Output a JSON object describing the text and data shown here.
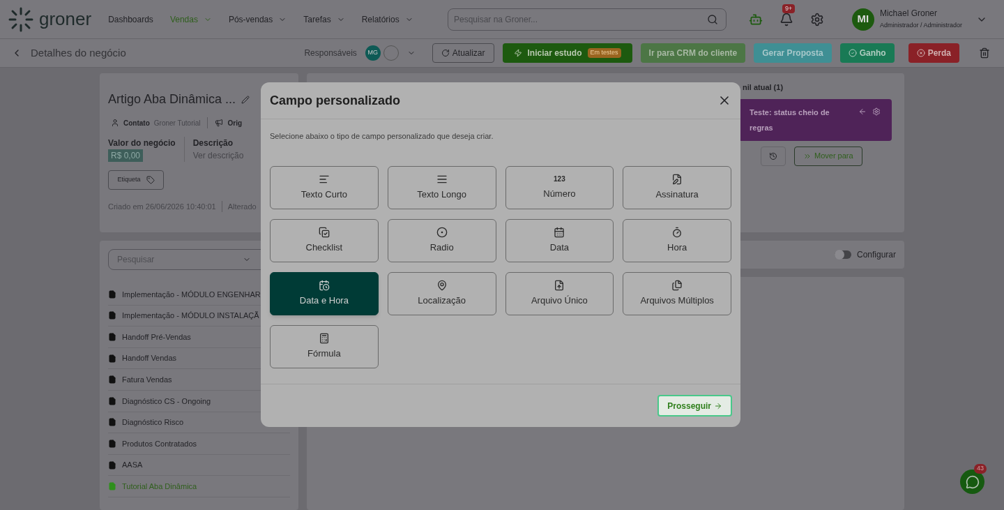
{
  "nav": {
    "logo": "groner",
    "menu": [
      {
        "label": "Dashboards",
        "selected": false,
        "caret": false
      },
      {
        "label": "Vendas",
        "selected": true,
        "caret": true
      },
      {
        "label": "Pós-vendas",
        "selected": false,
        "caret": true
      },
      {
        "label": "Tarefas",
        "selected": false,
        "caret": true
      },
      {
        "label": "Relatórios",
        "selected": false,
        "caret": true
      }
    ],
    "search": {
      "placeholder": "Pesquisar na Groner..."
    },
    "notifications": "9+",
    "user": {
      "initials": "MI",
      "name": "Michael Groner",
      "role": "Administrador / Administrador"
    }
  },
  "subbar": {
    "title": "Detalhes do negócio",
    "responsaveis": "Responsáveis",
    "avatar": "MG",
    "refresh": "Atualizar",
    "study": "Iniciar estudo",
    "study_badge": "Em testes",
    "crm": "Ir para CRM do cliente",
    "proposal": "Gerar Proposta",
    "won": "Ganho",
    "lost": "Perda"
  },
  "deal": {
    "title": "Artigo Aba Dinâmica ...",
    "contact_label": "Contato",
    "contact": "Groner Tutorial",
    "origin": "Orig",
    "value_label": "Valor do negócio",
    "value": "R$ 0,00",
    "description_label": "Descrição",
    "description": "Ver descrição",
    "tag": "Etiqueta",
    "created": "Criado em 26/06/2026 10:40:01",
    "changed": "Alterado"
  },
  "tabs": {
    "placeholder": "Pesquisar",
    "items": [
      {
        "label": "Implementação - MÓDULO ENGENHAR",
        "selected": false
      },
      {
        "label": "Implementação - MÓDULO INSTALAÇÃ",
        "selected": false
      },
      {
        "label": "Handoff Pré-Vendas",
        "selected": false
      },
      {
        "label": "Handoff Vendas",
        "selected": false
      },
      {
        "label": "Fatura Vendas",
        "selected": false
      },
      {
        "label": "Diagnóstico CS - Ongoing",
        "selected": false
      },
      {
        "label": "Diagnóstico Risco",
        "selected": false
      },
      {
        "label": "Produtos Contratados",
        "selected": false
      },
      {
        "label": "AASA",
        "selected": false
      },
      {
        "label": "Tutorial Aba Dinâmica",
        "selected": true
      }
    ]
  },
  "funnel": {
    "label": "nil atual (1)",
    "status": "Teste: status cheio de regras",
    "move": "Mover para",
    "configure": {
      "label": "Configurar",
      "on": false
    }
  },
  "modal": {
    "title": "Campo personalizado",
    "description": "Selecione abaixo o tipo de campo personalizado que deseja criar.",
    "options": [
      {
        "kind": "short-text",
        "label": "Texto Curto",
        "selected": false
      },
      {
        "kind": "long-text",
        "label": "Texto Longo",
        "selected": false
      },
      {
        "kind": "number",
        "label": "Número",
        "icon_text": "123",
        "selected": false
      },
      {
        "kind": "signature",
        "label": "Assinatura",
        "selected": false
      },
      {
        "kind": "checklist",
        "label": "Checklist",
        "selected": false
      },
      {
        "kind": "radio",
        "label": "Radio",
        "selected": false
      },
      {
        "kind": "date",
        "label": "Data",
        "selected": false
      },
      {
        "kind": "time",
        "label": "Hora",
        "selected": false
      },
      {
        "kind": "datetime",
        "label": "Data e Hora",
        "selected": true
      },
      {
        "kind": "location",
        "label": "Localização",
        "selected": false
      },
      {
        "kind": "file",
        "label": "Arquivo Único",
        "selected": false
      },
      {
        "kind": "files",
        "label": "Arquivos Múltiplos",
        "selected": false
      },
      {
        "kind": "formula",
        "label": "Fórmula",
        "selected": false
      }
    ],
    "proceed": "Prosseguir"
  },
  "chat_badge": "43"
}
